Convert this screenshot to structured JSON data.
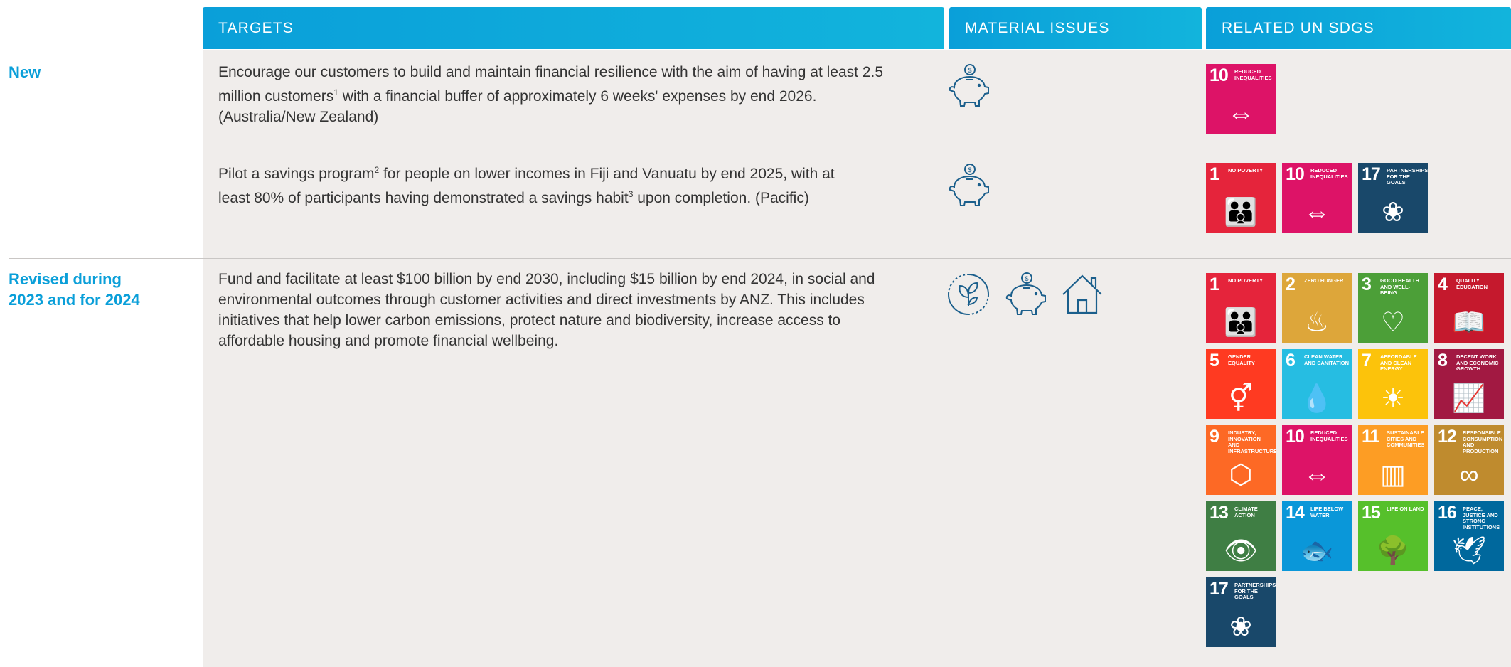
{
  "headers": {
    "targets": "TARGETS",
    "material_issues": "MATERIAL ISSUES",
    "related_sdgs": "RELATED UN SDGS"
  },
  "rows": [
    {
      "label": "New",
      "text_parts": [
        "Encourage our customers to build and maintain financial resilience with the aim of having at least 2.5 million customers",
        "1",
        " with a financial buffer of approximately 6 weeks' expenses by end 2026. (Australia/New Zealand)"
      ],
      "issues": [
        "piggy-bank-icon"
      ],
      "sdgs": [
        10
      ]
    },
    {
      "label": "",
      "text_parts": [
        "Pilot a savings program",
        "2",
        " for people on lower incomes in Fiji and Vanuatu by end 2025, with at least 80% of participants having demonstrated a savings habit",
        "3",
        " upon completion. (Pacific)"
      ],
      "issues": [
        "piggy-bank-icon"
      ],
      "sdgs": [
        1,
        10,
        17
      ]
    },
    {
      "label_line1": "Revised during",
      "label_line2": "2023 and for 2024",
      "text": "Fund and facilitate at least $100 billion by end 2030, including $15 billion by end 2024, in social and environmental outcomes through customer activities and direct investments by ANZ. This includes initiatives that help lower carbon emissions, protect nature and biodiversity, increase access to affordable housing and promote financial wellbeing.",
      "issues": [
        "leaf-cycle-icon",
        "piggy-bank-icon",
        "house-icon"
      ],
      "sdgs": [
        1,
        2,
        3,
        4,
        5,
        6,
        7,
        8,
        9,
        10,
        11,
        12,
        13,
        14,
        15,
        16,
        17
      ]
    }
  ],
  "sdg_tiles": {
    "1": {
      "num": "1",
      "title": "No poverty",
      "color": "#e5243b",
      "glyph": "👪"
    },
    "2": {
      "num": "2",
      "title": "Zero hunger",
      "color": "#dda63a",
      "glyph": "♨"
    },
    "3": {
      "num": "3",
      "title": "Good health and well-being",
      "color": "#4c9f38",
      "glyph": "♡"
    },
    "4": {
      "num": "4",
      "title": "Quality education",
      "color": "#c5192d",
      "glyph": "📖"
    },
    "5": {
      "num": "5",
      "title": "Gender equality",
      "color": "#ff3a21",
      "glyph": "⚥"
    },
    "6": {
      "num": "6",
      "title": "Clean water and sanitation",
      "color": "#26bde2",
      "glyph": "💧"
    },
    "7": {
      "num": "7",
      "title": "Affordable and clean energy",
      "color": "#fcc30b",
      "glyph": "☀"
    },
    "8": {
      "num": "8",
      "title": "Decent work and economic growth",
      "color": "#a21942",
      "glyph": "📈"
    },
    "9": {
      "num": "9",
      "title": "Industry, innovation and infrastructure",
      "color": "#fd6925",
      "glyph": "⬡"
    },
    "10": {
      "num": "10",
      "title": "Reduced inequalities",
      "color": "#dd1367",
      "glyph": "⇔"
    },
    "11": {
      "num": "11",
      "title": "Sustainable cities and communities",
      "color": "#fd9d24",
      "glyph": "▥"
    },
    "12": {
      "num": "12",
      "title": "Responsible consumption and production",
      "color": "#bf8b2e",
      "glyph": "∞"
    },
    "13": {
      "num": "13",
      "title": "Climate action",
      "color": "#3f7e44",
      "glyph": "👁"
    },
    "14": {
      "num": "14",
      "title": "Life below water",
      "color": "#0a97d9",
      "glyph": "🐟"
    },
    "15": {
      "num": "15",
      "title": "Life on land",
      "color": "#56c02b",
      "glyph": "🌳"
    },
    "16": {
      "num": "16",
      "title": "Peace, justice and strong institutions",
      "color": "#00689d",
      "glyph": "🕊"
    },
    "17": {
      "num": "17",
      "title": "Partnerships for the goals",
      "color": "#19486a",
      "glyph": "❀"
    }
  }
}
